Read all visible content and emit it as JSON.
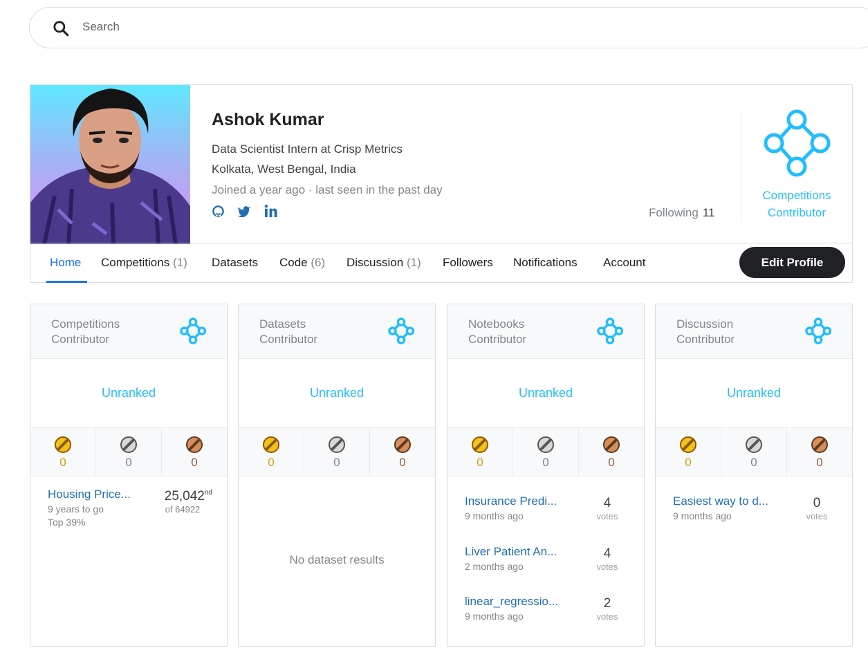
{
  "search": {
    "placeholder": "Search"
  },
  "profile": {
    "name": "Ashok Kumar",
    "occupation": "Data Scientist Intern at Crisp Metrics",
    "location": "Kolkata, West Bengal, India",
    "joined": "Joined a year ago · last seen in the past day",
    "following_label": "Following",
    "following_count": "11",
    "tier_line1": "Competitions",
    "tier_line2": "Contributor",
    "social_icons": [
      "github-icon",
      "twitter-icon",
      "linkedin-icon"
    ]
  },
  "tabs": [
    {
      "label": "Home",
      "count": ""
    },
    {
      "label": "Competitions",
      "count": "(1)"
    },
    {
      "label": "Datasets",
      "count": ""
    },
    {
      "label": "Code",
      "count": "(6)"
    },
    {
      "label": "Discussion",
      "count": "(1)"
    },
    {
      "label": "Followers",
      "count": ""
    },
    {
      "label": "Notifications",
      "count": ""
    },
    {
      "label": "Account",
      "count": ""
    }
  ],
  "edit_profile_label": "Edit Profile",
  "colors": {
    "accent": "#20beff",
    "link": "#1f6fb2",
    "gold": "#d29d0c",
    "silver": "#838383",
    "bronze": "#8e5b3d"
  },
  "cards": [
    {
      "title1": "Competitions",
      "title2": "Contributor",
      "rank": "Unranked",
      "gold": "0",
      "silver": "0",
      "bronze": "0",
      "competition": {
        "title": "Housing Price...",
        "sub": "9 years to go",
        "top": "Top 39%",
        "place": "25,042",
        "suffix": "nd",
        "of": "of 64922"
      }
    },
    {
      "title1": "Datasets",
      "title2": "Contributor",
      "rank": "Unranked",
      "gold": "0",
      "silver": "0",
      "bronze": "0",
      "empty": "No dataset results"
    },
    {
      "title1": "Notebooks",
      "title2": "Contributor",
      "rank": "Unranked",
      "gold": "0",
      "silver": "0",
      "bronze": "0",
      "items": [
        {
          "title": "Insurance Predi...",
          "sub": "9 months ago",
          "votes": "4",
          "votes_label": "votes"
        },
        {
          "title": "Liver Patient An...",
          "sub": "2 months ago",
          "votes": "4",
          "votes_label": "votes"
        },
        {
          "title": "linear_regressio...",
          "sub": "9 months ago",
          "votes": "2",
          "votes_label": "votes"
        }
      ]
    },
    {
      "title1": "Discussion",
      "title2": "Contributor",
      "rank": "Unranked",
      "gold": "0",
      "silver": "0",
      "bronze": "0",
      "items": [
        {
          "title": "Easiest way to d...",
          "sub": "9 months ago",
          "votes": "0",
          "votes_label": "votes"
        }
      ]
    }
  ]
}
